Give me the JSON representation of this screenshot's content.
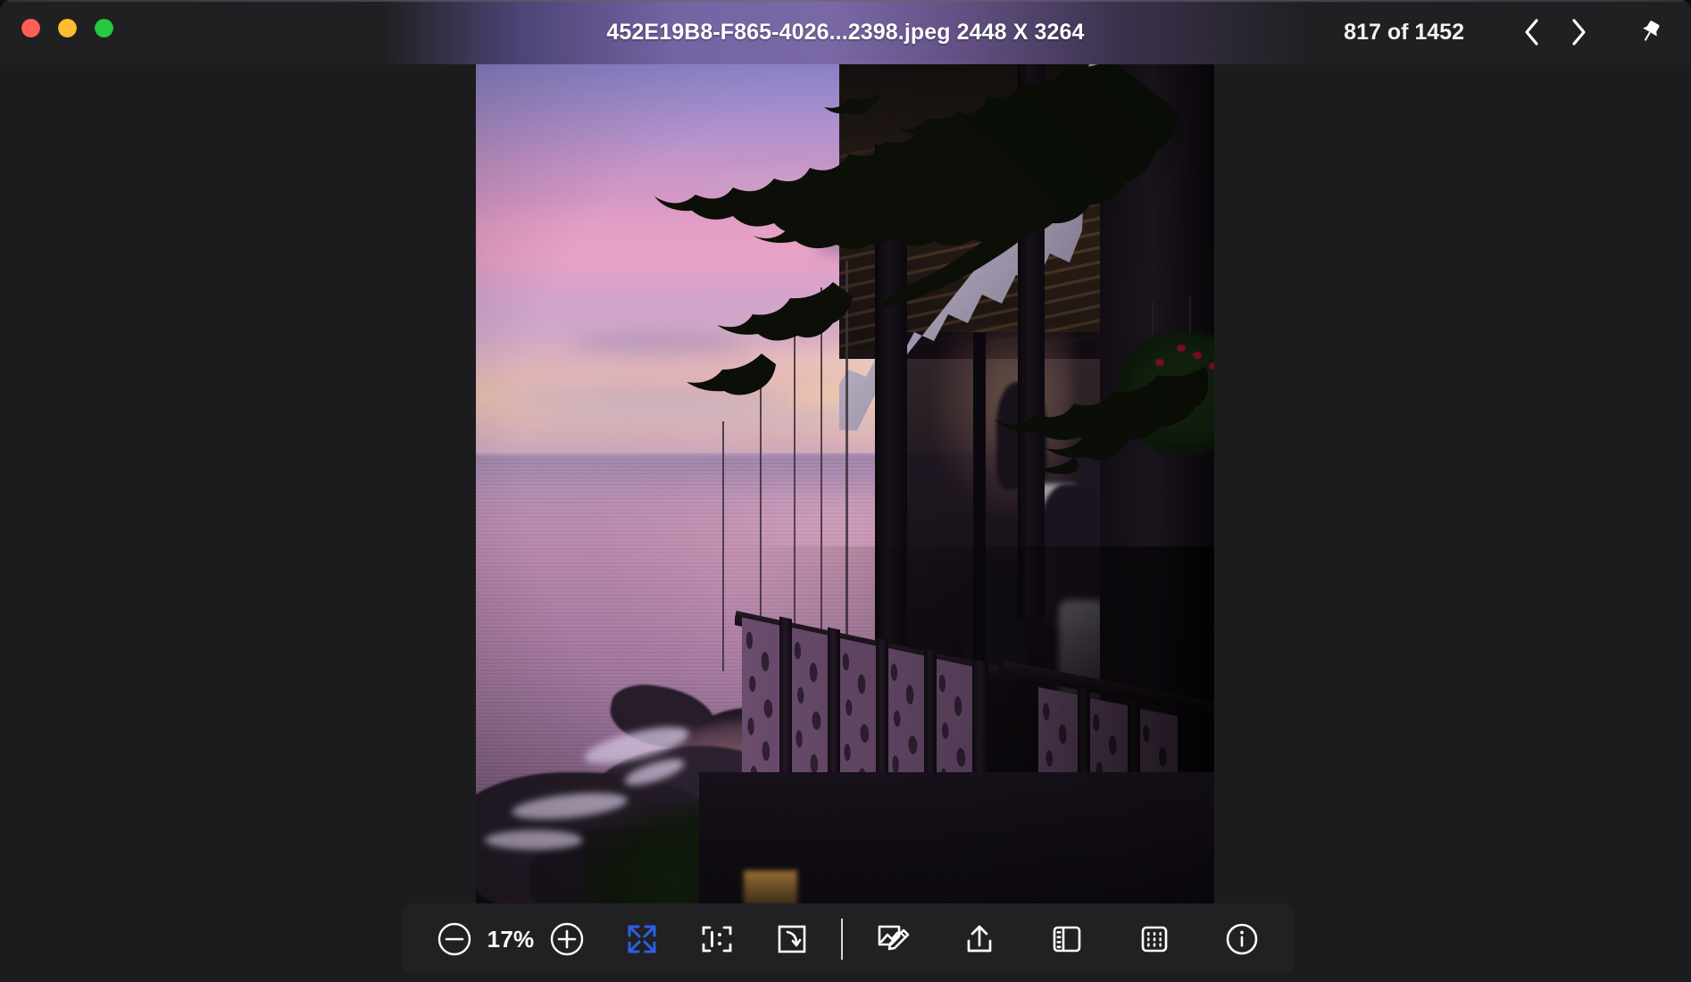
{
  "window": {
    "traffic_lights": [
      {
        "name": "close",
        "color": "#ff5f57"
      },
      {
        "name": "minimize",
        "color": "#febc2e"
      },
      {
        "name": "maximize",
        "color": "#28c840"
      }
    ],
    "title": "452E19B8-F865-4026...2398.jpeg 2448 X 3264",
    "counter": "817 of 1452",
    "nav": {
      "previous_icon": "chevron-left-icon",
      "next_icon": "chevron-right-icon",
      "pin_icon": "pushpin-icon"
    },
    "background_color": "#1c1c1e",
    "titlebar_color": "#202022",
    "vibrancy_accent": "#7e6cac"
  },
  "image": {
    "file_name": "452E19B8-F865-4026...2398.jpeg",
    "dimensions": "2448 X 3264",
    "alt": "Tropical sunset over ocean seen from a wooden terrace with scalloped awning, hanging flower baskets and carved purple balustrade",
    "palette": {
      "sky_upper": "#8f86ce",
      "sky_pink": "#dc9ec6",
      "sky_glow": "#ffeec8",
      "sea": "#b08aae",
      "sea_deep": "#6d5070",
      "rock": "#241a26",
      "balustrade": "#6b4d6e",
      "structure_dark": "#120d14",
      "foliage": "#15240f",
      "flower": "#7e1024",
      "awning": "#c9c2d4"
    }
  },
  "toolbar": {
    "background": "#212123",
    "zoom_out": {
      "label": "Zoom Out",
      "icon": "minus-circle-icon"
    },
    "zoom_level": "17%",
    "zoom_in": {
      "label": "Zoom In",
      "icon": "plus-circle-icon"
    },
    "fit_screen": {
      "label": "Zoom to Fit",
      "icon": "expand-arrows-icon",
      "active": true,
      "active_color": "#2d5fe8"
    },
    "actual_size": {
      "label": "Actual Size",
      "icon": "actual-size-icon"
    },
    "rotate": {
      "label": "Rotate",
      "icon": "rotate-icon"
    },
    "markup": {
      "label": "Markup",
      "icon": "markup-pencil-icon"
    },
    "share": {
      "label": "Share",
      "icon": "share-icon"
    },
    "sidebar": {
      "label": "Sidebar",
      "icon": "sidebar-toggle-icon"
    },
    "contact_sheet": {
      "label": "Contact Sheet",
      "icon": "grid-icon"
    },
    "info": {
      "label": "Info",
      "icon": "info-circle-icon"
    }
  }
}
